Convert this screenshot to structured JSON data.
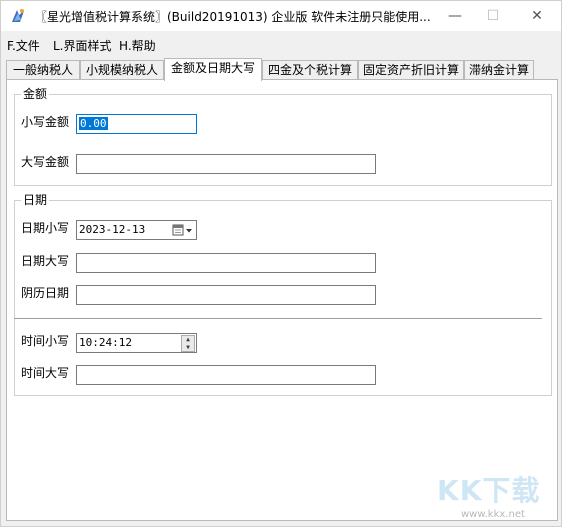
{
  "window": {
    "title": "〖星光增值税计算系统〗(Build20191013) 企业版 软件未注册只能使用...",
    "min_glyph": "—",
    "max_glyph": "☐",
    "close_glyph": "✕"
  },
  "menu": [
    "F.文件",
    "L.界面样式",
    "H.帮助"
  ],
  "tabs": [
    "一般纳税人",
    "小规模纳税人",
    "金额及日期大写",
    "四金及个税计算",
    "固定资产折旧计算",
    "滞纳金计算"
  ],
  "active_tab": 2,
  "amount_group": {
    "title": "金额",
    "lower_label": "小写金额",
    "lower_value": "0.00",
    "upper_label": "大写金额",
    "upper_value": ""
  },
  "date_group": {
    "title": "日期",
    "date_lower_label": "日期小写",
    "date_lower_value": "2023-12-13",
    "date_upper_label": "日期大写",
    "date_upper_value": "",
    "lunar_label": "阴历日期",
    "lunar_value": "",
    "time_lower_label": "时间小写",
    "time_lower_value": "10:24:12",
    "time_upper_label": "时间大写",
    "time_upper_value": ""
  },
  "watermark": {
    "text": "KK下载",
    "url": "www.kkx.net"
  },
  "colors": {
    "accent": "#0078d7",
    "window_bg": "#f0f0f0"
  }
}
